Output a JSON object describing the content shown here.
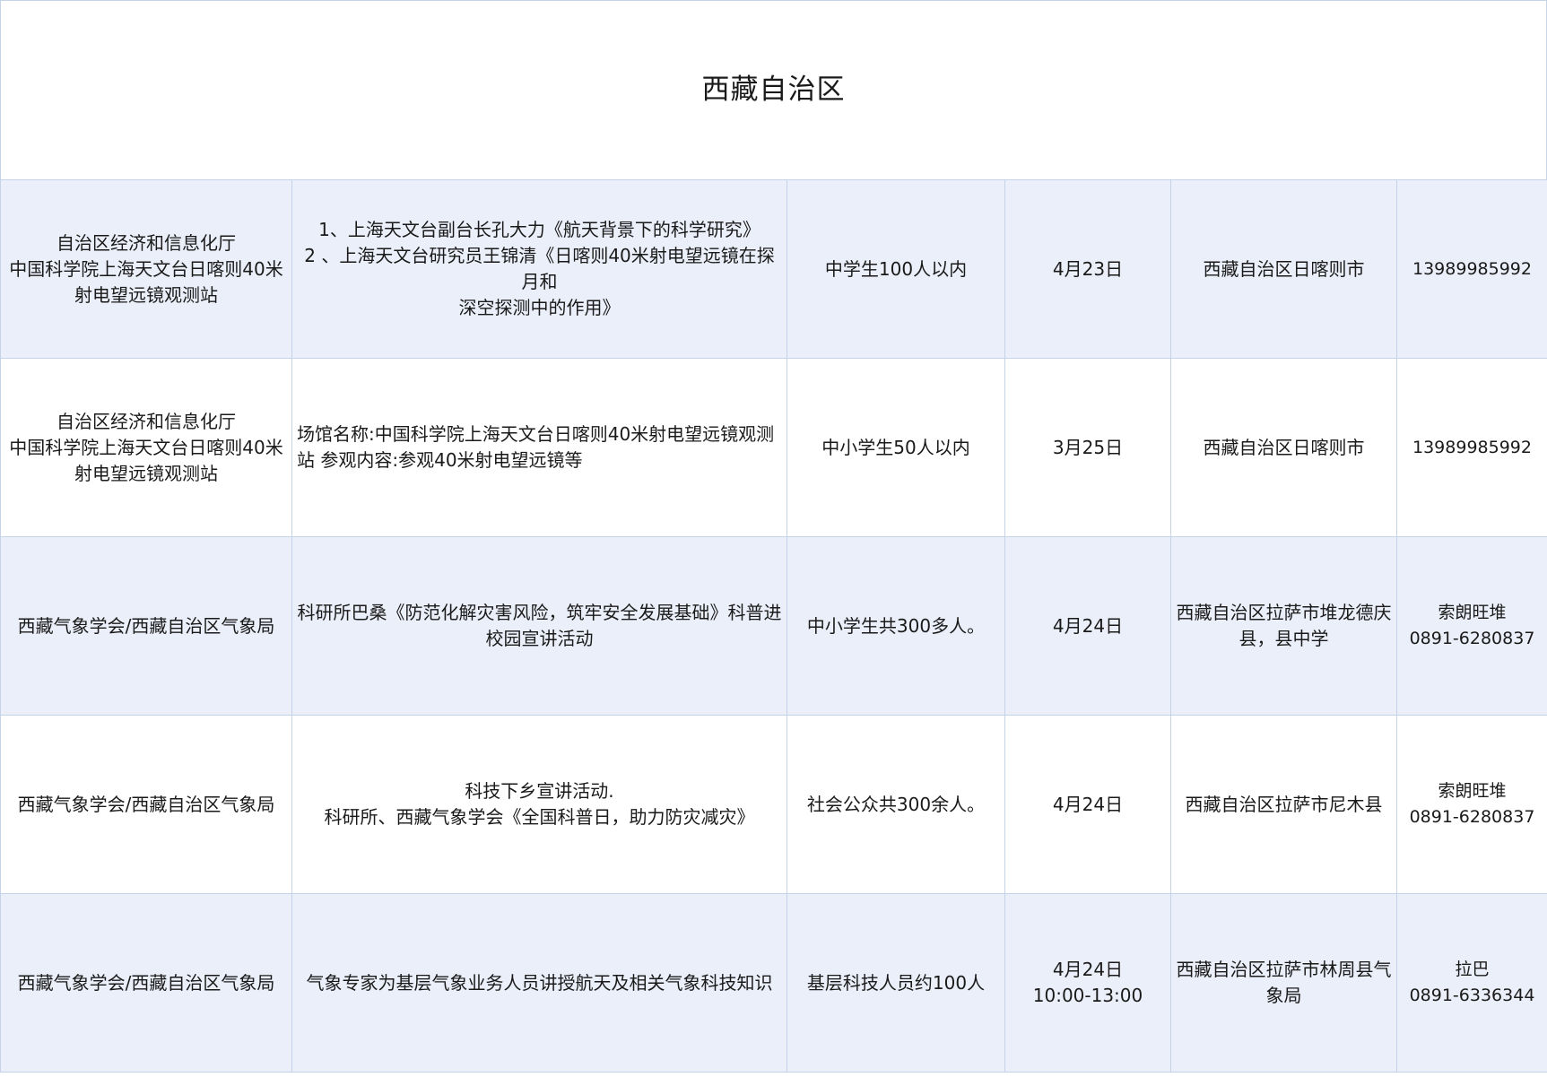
{
  "title": "西藏自治区",
  "rows": [
    {
      "organizer": "自治区经济和信息化厅\n中国科学院上海天文台日喀则40米射电望远镜观测站",
      "content": "1、上海天文台副台长孔大力《航天背景下的科学研究》\n2 、上海天文台研究员王锦清《日喀则40米射电望远镜在探月和\n深空探测中的作用》",
      "audience": "中学生100人以内",
      "date": "4月23日",
      "location": "西藏自治区日喀则市",
      "contact": "13989985992"
    },
    {
      "organizer": "自治区经济和信息化厅\n中国科学院上海天文台日喀则40米射电望远镜观测站",
      "content": "场馆名称:中国科学院上海天文台日喀则40米射电望远镜观测站                          参观内容:参观40米射电望远镜等",
      "audience": "中小学生50人以内",
      "date": "3月25日",
      "location": "西藏自治区日喀则市",
      "contact": "13989985992"
    },
    {
      "organizer": "西藏气象学会/西藏自治区气象局",
      "content": "科研所巴桑《防范化解灾害风险，筑牢安全发展基础》科普进校园宣讲活动",
      "audience": "中小学生共300多人。",
      "date": "4月24日",
      "location": "西藏自治区拉萨市堆龙德庆县，县中学",
      "contact": "索朗旺堆\n0891-6280837"
    },
    {
      "organizer": "西藏气象学会/西藏自治区气象局",
      "content": "科技下乡宣讲活动.\n科研所、西藏气象学会《全国科普日，助力防灾减灾》",
      "audience": "社会公众共300余人。",
      "date": "4月24日",
      "location": "西藏自治区拉萨市尼木县",
      "contact": "索朗旺堆\n0891-6280837"
    },
    {
      "organizer": "西藏气象学会/西藏自治区气象局",
      "content": "气象专家为基层气象业务人员讲授航天及相关气象科技知识",
      "audience": "基层科技人员约100人",
      "date": "4月24日\n10:00-13:00",
      "location": "西藏自治区拉萨市林周县气象局",
      "contact": "拉巴\n0891-6336344"
    }
  ]
}
